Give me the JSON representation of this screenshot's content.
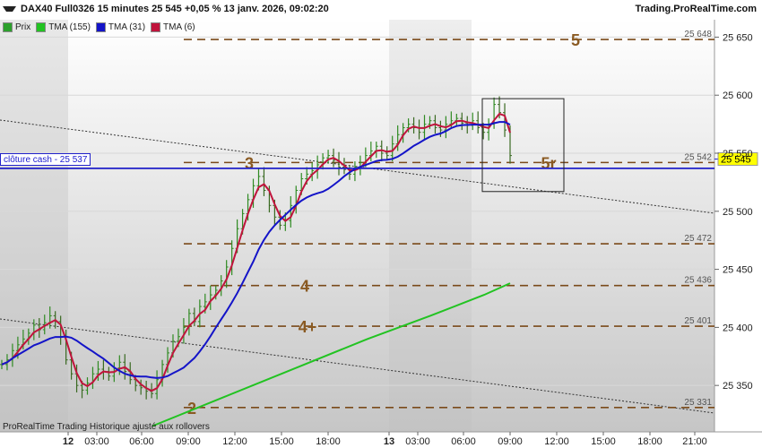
{
  "header": {
    "title": "DAX40 Full0326 15 minutes 25 545 +0,05 % 13 janv. 2026, 09:02:20",
    "brand": "Trading.ProRealTime.com",
    "collapse_icon": "triangle-down-icon"
  },
  "legend": [
    {
      "label": "Prix",
      "color": "#2ca02c"
    },
    {
      "label": "TMA (155)",
      "color": "#22c322"
    },
    {
      "label": "TMA (31)",
      "color": "#1414c8"
    },
    {
      "label": "TMA (6)",
      "color": "#c0143c"
    }
  ],
  "footer": "ProRealTime Trading  Historique ajusté aux rollovers",
  "cash_label": "clôture cash -  25 537",
  "chart_data": {
    "type": "line",
    "title": "DAX40 Full0326 15 minutes",
    "ylim": [
      25310,
      25665
    ],
    "yticks": [
      {
        "value": 25650,
        "label": "25 650"
      },
      {
        "value": 25600,
        "label": "25 600"
      },
      {
        "value": 25550,
        "label": "25 550"
      },
      {
        "value": 25500,
        "label": "25 500"
      },
      {
        "value": 25450,
        "label": "25 450"
      },
      {
        "value": 25400,
        "label": "25 400"
      },
      {
        "value": 25350,
        "label": "25 350"
      }
    ],
    "xticks": [
      "12",
      "03:00",
      "06:00",
      "09:00",
      "12:00",
      "15:00",
      "18:00",
      "13",
      "03:00",
      "06:00",
      "09:00",
      "12:00",
      "15:00",
      "18:00",
      "21:00"
    ],
    "x_bold": [
      "12",
      "13"
    ],
    "last_price": {
      "value": 25545,
      "label": "25 545"
    },
    "cash_close": {
      "value": 25537,
      "label": "clôture cash -  25 537"
    },
    "levels": [
      {
        "value": 25648,
        "label": "25 648",
        "tag": "5"
      },
      {
        "value": 25542,
        "label": "25 542",
        "tag": "5r"
      },
      {
        "value": 25472,
        "label": "25 472",
        "tag": ""
      },
      {
        "value": 25436,
        "label": "25 436",
        "tag": "4"
      },
      {
        "value": 25401,
        "label": "25 401",
        "tag": "4+"
      },
      {
        "value": 25331,
        "label": "25 331",
        "tag": "2"
      }
    ],
    "wave_label_3": "3",
    "price_close_series": [
      25368,
      25372,
      25380,
      25385,
      25390,
      25395,
      25402,
      25398,
      25404,
      25410,
      25405,
      25392,
      25372,
      25360,
      25350,
      25346,
      25352,
      25360,
      25364,
      25362,
      25358,
      25365,
      25370,
      25362,
      25355,
      25350,
      25348,
      25345,
      25343,
      25355,
      25368,
      25378,
      25388,
      25392,
      25400,
      25412,
      25405,
      25418,
      25422,
      25428,
      25432,
      25440,
      25452,
      25468,
      25485,
      25498,
      25510,
      25522,
      25530,
      25518,
      25505,
      25495,
      25488,
      25492,
      25505,
      25518,
      25528,
      25532,
      25535,
      25540,
      25546,
      25548,
      25544,
      25538,
      25536,
      25532,
      25538,
      25542,
      25548,
      25552,
      25556,
      25550,
      25548,
      25558,
      25566,
      25572,
      25575,
      25572,
      25568,
      25575,
      25578,
      25572,
      25570,
      25575,
      25578,
      25580,
      25576,
      25574,
      25578,
      25572,
      25568,
      25575,
      25592,
      25585,
      25570,
      25548
    ]
  }
}
